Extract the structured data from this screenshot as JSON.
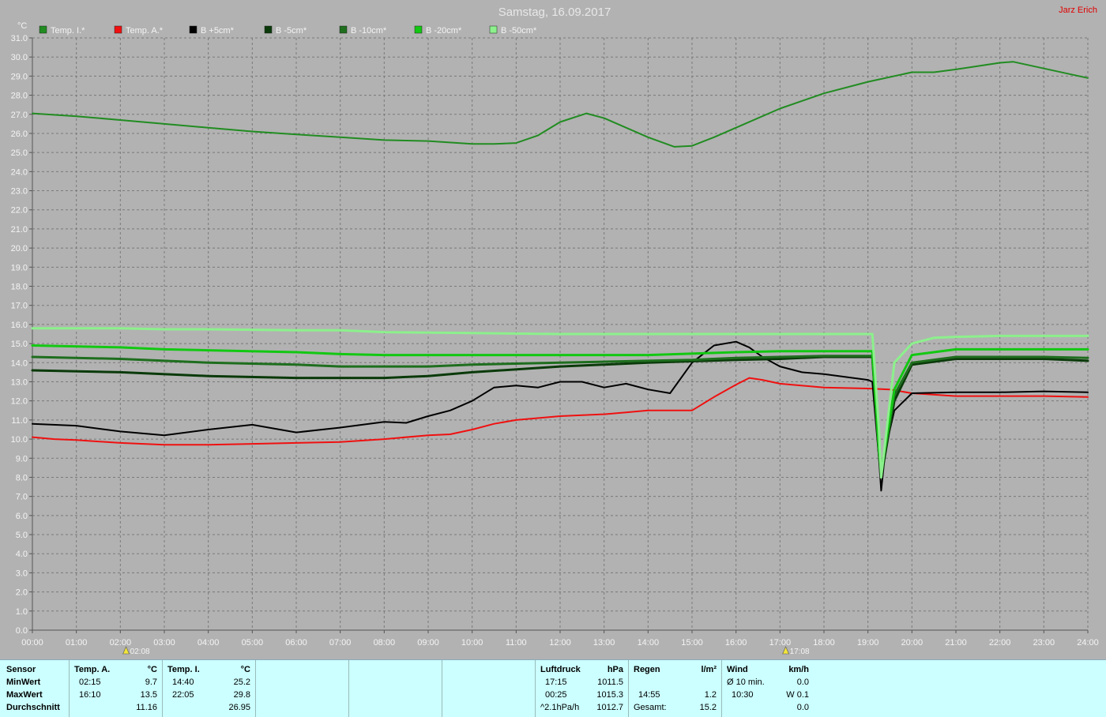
{
  "title": "Samstag, 16.09.2017",
  "author": "Jarz Erich",
  "colors": {
    "background": "#b2b2b2",
    "grid": "#7a7a7a",
    "stats_bg": "#ccffff"
  },
  "legend": [
    {
      "label": "Temp. I.*",
      "color": "#218c21"
    },
    {
      "label": "Temp. A.*",
      "color": "#f01010"
    },
    {
      "label": "B +5cm*",
      "color": "#000000"
    },
    {
      "label": "B -5cm*",
      "color": "#0a3a0a"
    },
    {
      "label": "B -10cm*",
      "color": "#1e6e1e"
    },
    {
      "label": "B -20cm*",
      "color": "#12c812"
    },
    {
      "label": "B -50cm*",
      "color": "#8cf08c"
    }
  ],
  "markers": [
    {
      "time": 2.13,
      "label": "02:08"
    },
    {
      "time": 17.13,
      "label": "17:08"
    }
  ],
  "chart_data": {
    "type": "line",
    "ylabel": "°C",
    "ylim": [
      0,
      31
    ],
    "yticks": [
      "0.0",
      "1.0",
      "2.0",
      "3.0",
      "4.0",
      "5.0",
      "6.0",
      "7.0",
      "8.0",
      "9.0",
      "10.0",
      "11.0",
      "12.0",
      "13.0",
      "14.0",
      "15.0",
      "16.0",
      "17.0",
      "18.0",
      "19.0",
      "20.0",
      "21.0",
      "22.0",
      "23.0",
      "24.0",
      "25.0",
      "26.0",
      "27.0",
      "28.0",
      "29.0",
      "30.0",
      "31.0"
    ],
    "xlim": [
      0,
      24
    ],
    "xticks": [
      "00:00",
      "01:00",
      "02:00",
      "03:00",
      "04:00",
      "05:00",
      "06:00",
      "07:00",
      "08:00",
      "09:00",
      "10:00",
      "11:00",
      "12:00",
      "13:00",
      "14:00",
      "15:00",
      "16:00",
      "17:00",
      "18:00",
      "19:00",
      "20:00",
      "21:00",
      "22:00",
      "23:00",
      "24:00"
    ],
    "grid": true,
    "legend_position": "top-left",
    "series": [
      {
        "name": "Temp. I.*",
        "color": "#218c21",
        "width": 2,
        "x": [
          0,
          1,
          2,
          3,
          4,
          5,
          6,
          7,
          8,
          9,
          10,
          10.5,
          11,
          11.5,
          12,
          12.6,
          13,
          14,
          14.6,
          15,
          15.5,
          16,
          17,
          18,
          19,
          20,
          20.5,
          21,
          22,
          22.3,
          23,
          24
        ],
        "y": [
          27.05,
          26.9,
          26.7,
          26.5,
          26.3,
          26.1,
          25.95,
          25.8,
          25.65,
          25.6,
          25.45,
          25.45,
          25.5,
          25.9,
          26.6,
          27.05,
          26.8,
          25.8,
          25.3,
          25.35,
          25.8,
          26.3,
          27.3,
          28.1,
          28.7,
          29.2,
          29.2,
          29.35,
          29.7,
          29.75,
          29.4,
          28.9
        ]
      },
      {
        "name": "Temp. A.*",
        "color": "#f01010",
        "width": 2,
        "x": [
          0,
          0.5,
          1,
          2,
          3,
          4,
          5,
          6,
          7,
          8,
          9,
          9.5,
          10,
          10.5,
          11,
          12,
          13,
          13.5,
          14,
          14.6,
          15,
          15.5,
          16,
          16.3,
          16.6,
          17,
          18,
          19,
          19.5,
          20,
          21,
          22,
          23,
          24
        ],
        "y": [
          10.1,
          10.0,
          9.95,
          9.8,
          9.7,
          9.7,
          9.75,
          9.8,
          9.85,
          10.0,
          10.2,
          10.25,
          10.5,
          10.8,
          11.0,
          11.2,
          11.3,
          11.4,
          11.5,
          11.5,
          11.5,
          12.2,
          12.85,
          13.2,
          13.1,
          12.9,
          12.7,
          12.65,
          12.6,
          12.4,
          12.25,
          12.25,
          12.25,
          12.2
        ]
      },
      {
        "name": "B +5cm*",
        "color": "#000000",
        "width": 2,
        "x": [
          0,
          1,
          2,
          3,
          4,
          5,
          6,
          7,
          8,
          8.5,
          9,
          9.5,
          10,
          10.5,
          11,
          11.5,
          12,
          12.5,
          13,
          13.5,
          14,
          14.5,
          15,
          15.5,
          16,
          16.3,
          16.6,
          17,
          17.5,
          18,
          19,
          19.1,
          19.25,
          19.3,
          19.4,
          19.6,
          20,
          21,
          22,
          23,
          24
        ],
        "y": [
          10.8,
          10.7,
          10.4,
          10.2,
          10.5,
          10.75,
          10.35,
          10.6,
          10.9,
          10.85,
          11.2,
          11.5,
          12.0,
          12.7,
          12.8,
          12.7,
          13.0,
          13.0,
          12.7,
          12.9,
          12.6,
          12.4,
          14.0,
          14.9,
          15.1,
          14.8,
          14.3,
          13.8,
          13.5,
          13.4,
          13.1,
          13.0,
          9.0,
          7.3,
          9.5,
          11.5,
          12.4,
          12.45,
          12.45,
          12.5,
          12.45
        ]
      },
      {
        "name": "B -5cm*",
        "color": "#0a3a0a",
        "width": 3,
        "x": [
          0,
          2,
          4,
          6,
          7,
          8,
          9,
          10,
          12,
          14,
          16,
          17,
          18,
          19,
          19.1,
          19.25,
          19.3,
          19.6,
          20,
          21,
          22,
          23,
          24
        ],
        "y": [
          13.6,
          13.5,
          13.3,
          13.2,
          13.2,
          13.2,
          13.3,
          13.5,
          13.8,
          14.0,
          14.15,
          14.2,
          14.3,
          14.3,
          14.3,
          9.2,
          8.0,
          12.0,
          13.9,
          14.2,
          14.2,
          14.2,
          14.1
        ]
      },
      {
        "name": "B -10cm*",
        "color": "#1e6e1e",
        "width": 3,
        "x": [
          0,
          2,
          4,
          6,
          7,
          8,
          9,
          10,
          12,
          14,
          15,
          16,
          17,
          18,
          19,
          19.1,
          19.25,
          19.3,
          19.6,
          20,
          21,
          22,
          23,
          24
        ],
        "y": [
          14.3,
          14.2,
          14.0,
          13.9,
          13.8,
          13.8,
          13.8,
          13.9,
          14.0,
          14.1,
          14.15,
          14.25,
          14.3,
          14.35,
          14.35,
          14.35,
          9.3,
          8.2,
          12.3,
          14.0,
          14.3,
          14.3,
          14.3,
          14.25
        ]
      },
      {
        "name": "B -20cm*",
        "color": "#12c812",
        "width": 3,
        "x": [
          0,
          2,
          3,
          4,
          6,
          7,
          8,
          10,
          12,
          14,
          16,
          17,
          18,
          19,
          19.1,
          19.25,
          19.3,
          19.6,
          20,
          21,
          22,
          23,
          24
        ],
        "y": [
          14.9,
          14.8,
          14.7,
          14.65,
          14.55,
          14.45,
          14.4,
          14.4,
          14.4,
          14.4,
          14.55,
          14.6,
          14.6,
          14.6,
          14.6,
          9.5,
          8.3,
          12.6,
          14.4,
          14.7,
          14.7,
          14.7,
          14.7
        ]
      },
      {
        "name": "B -50cm*",
        "color": "#8cf08c",
        "width": 3,
        "x": [
          0,
          2,
          3,
          4,
          6,
          7,
          8,
          10,
          12,
          14,
          16,
          18,
          19,
          19.1,
          19.25,
          19.3,
          19.6,
          20,
          20.5,
          21,
          22,
          23,
          24
        ],
        "y": [
          15.8,
          15.8,
          15.75,
          15.75,
          15.7,
          15.7,
          15.6,
          15.55,
          15.5,
          15.5,
          15.5,
          15.5,
          15.5,
          15.5,
          10.5,
          8.0,
          14.0,
          15.0,
          15.3,
          15.35,
          15.4,
          15.4,
          15.4
        ]
      }
    ]
  },
  "stats": {
    "sensor": {
      "header": "Sensor",
      "min": "MinWert",
      "max": "MaxWert",
      "avg": "Durchschnitt"
    },
    "temp_a": {
      "header": "Temp. A.",
      "unit": "°C",
      "min_time": "02:15",
      "min_val": "9.7",
      "max_time": "16:10",
      "max_val": "13.5",
      "avg_val": "11.16"
    },
    "temp_i": {
      "header": "Temp. I.",
      "unit": "°C",
      "min_time": "14:40",
      "min_val": "25.2",
      "max_time": "22:05",
      "max_val": "29.8",
      "avg_val": "26.95"
    },
    "pressure": {
      "header": "Luftdruck",
      "unit": "hPa",
      "min_time": "17:15",
      "min_val": "1011.5",
      "max_time": "00:25",
      "max_val": "1015.3",
      "avg_label": "^2.1hPa/h",
      "avg_val": "1012.7"
    },
    "rain": {
      "header": "Regen",
      "unit": "l/m²",
      "max_time": "14:55",
      "max_val": "1.2",
      "total_label": "Gesamt:",
      "total_val": "15.2"
    },
    "wind": {
      "header": "Wind",
      "unit": "km/h",
      "min_label": "Ø 10 min.",
      "min_val": "0.0",
      "max_time": "10:30",
      "max_val": "W 0.1",
      "avg_val": "0.0"
    }
  }
}
